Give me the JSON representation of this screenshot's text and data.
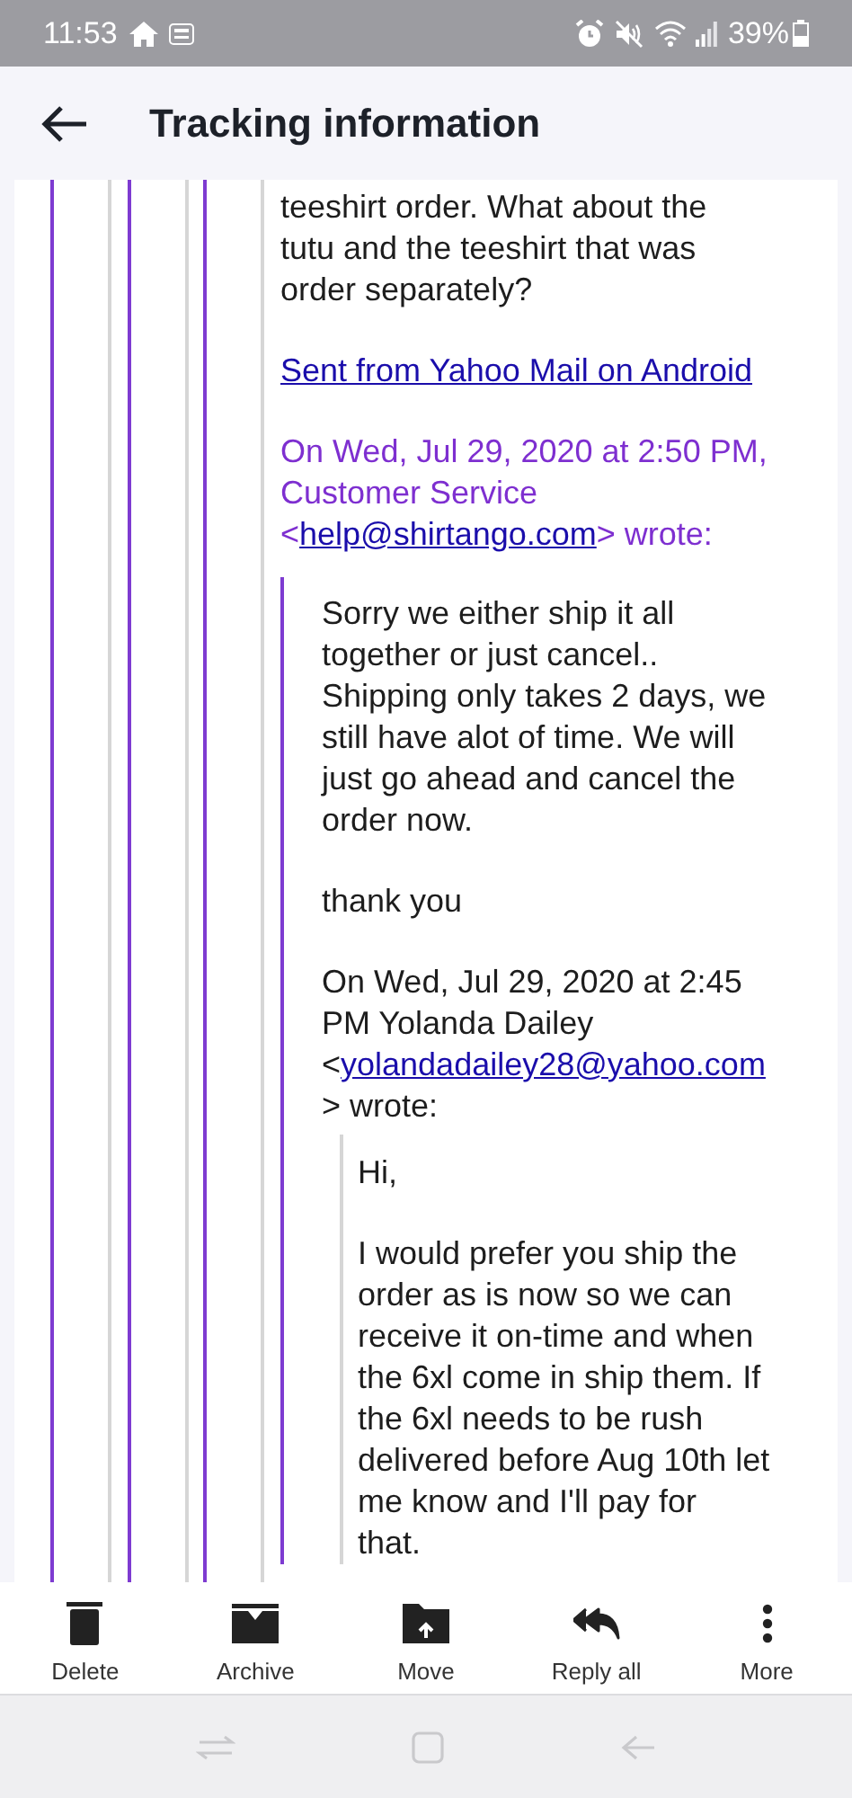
{
  "status_bar": {
    "time": "11:53",
    "battery": "39%"
  },
  "header": {
    "title": "Tracking information"
  },
  "thread": {
    "blocks": [
      {
        "kind": "text",
        "text": "teeshirt order. What about the\ntutu and the teeshirt that was\norder separately?"
      },
      {
        "kind": "link",
        "text": "Sent from Yahoo Mail on Android"
      },
      {
        "kind": "reply_header",
        "before": "On Wed, Jul 29, 2020 at 2:50 PM,\nCustomer Service\n<",
        "link": "help@shirtango.com",
        "after": "> wrote:"
      }
    ],
    "quote": {
      "blocks": [
        {
          "kind": "text",
          "text": "Sorry we either ship it all\ntogether or just cancel..\nShipping only takes 2 days, we\nstill have alot of time. We will\njust go ahead and cancel the\norder now."
        },
        {
          "kind": "text",
          "text": "thank you"
        },
        {
          "kind": "attribution",
          "before": "On Wed, Jul 29, 2020 at 2:45\nPM Yolanda Dailey\n<",
          "link": "yolandadailey28@yahoo.com",
          "after": "\n> wrote:"
        }
      ],
      "quote": {
        "blocks": [
          {
            "kind": "text",
            "text": "Hi,"
          },
          {
            "kind": "text",
            "text": "I would prefer you ship the\norder as is now so we can\nreceive it on-time and when\nthe 6xl come in ship them. If\nthe 6xl needs to be rush\ndelivered before Aug 10th let\nme know and I'll pay for\nthat."
          }
        ]
      }
    }
  },
  "toolbar": [
    {
      "kind": "delete",
      "label": "Delete"
    },
    {
      "kind": "archive",
      "label": "Archive"
    },
    {
      "kind": "move",
      "label": "Move"
    },
    {
      "kind": "reply_all",
      "label": "Reply all"
    },
    {
      "kind": "more",
      "label": "More"
    }
  ]
}
